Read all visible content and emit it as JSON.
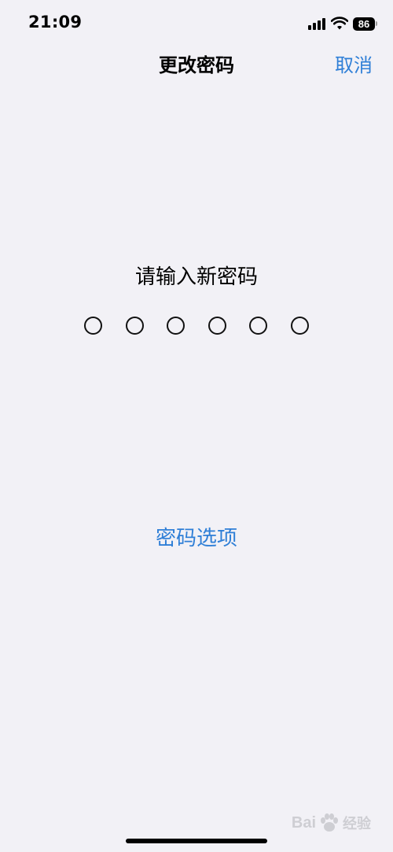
{
  "status_bar": {
    "time": "21:09",
    "battery_level": "86",
    "icons": [
      "signal-icon",
      "wifi-icon",
      "battery-icon"
    ]
  },
  "nav": {
    "title": "更改密码",
    "cancel_label": "取消"
  },
  "passcode": {
    "prompt": "请输入新密码",
    "digit_count": 6,
    "entered_count": 0
  },
  "options_link": "密码选项",
  "watermark": {
    "brand": "Bai",
    "suffix": "经验"
  },
  "colors": {
    "background": "#f2f1f6",
    "accent": "#2f7fd7",
    "text": "#000000"
  }
}
